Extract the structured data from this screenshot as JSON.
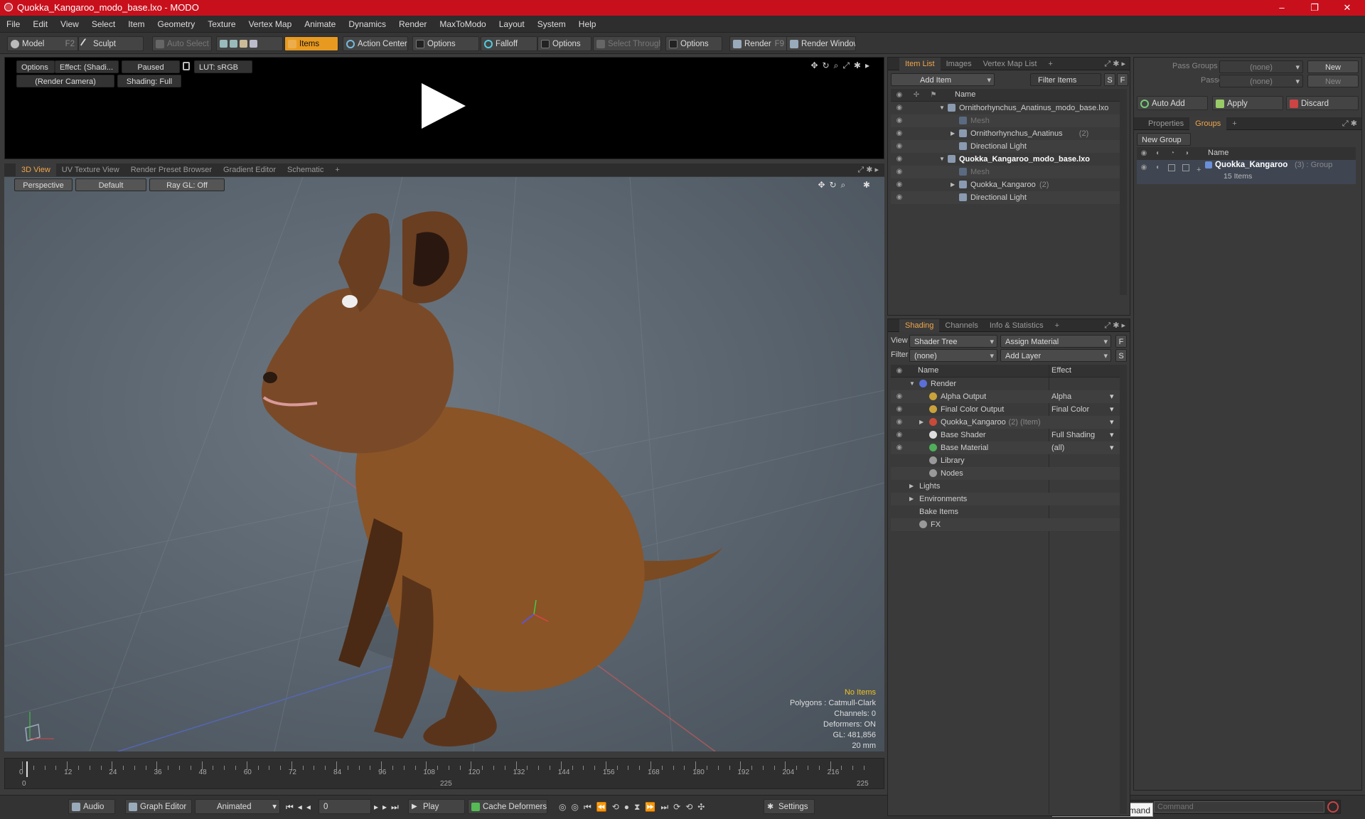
{
  "window": {
    "title": "Quokka_Kangaroo_modo_base.lxo - MODO",
    "minimize": "–",
    "restore": "❐",
    "close": "✕"
  },
  "menu": [
    "File",
    "Edit",
    "View",
    "Select",
    "Item",
    "Geometry",
    "Texture",
    "Vertex Map",
    "Animate",
    "Dynamics",
    "Render",
    "MaxToModo",
    "Layout",
    "System",
    "Help"
  ],
  "toolbar": {
    "model": "Model",
    "model_key": "F2",
    "sculpt": "Sculpt",
    "auto_select": "Auto Select",
    "items": "Items",
    "action_center": "Action Center",
    "options1": "Options",
    "falloff": "Falloff",
    "options2": "Options",
    "select_through": "Select Through",
    "options3": "Options",
    "render": "Render",
    "render_key": "F9",
    "render_window": "Render Window"
  },
  "preview": {
    "options": "Options",
    "effect": "Effect: (Shadi...",
    "paused": "Paused",
    "lut": "LUT: sRGB",
    "camera": "(Render Camera)",
    "shading": "Shading: Full"
  },
  "viewport_tabs": [
    {
      "label": "3D View",
      "active": true
    },
    {
      "label": "UV Texture View"
    },
    {
      "label": "Render Preset Browser"
    },
    {
      "label": "Gradient Editor"
    },
    {
      "label": "Schematic"
    },
    {
      "label": "+"
    }
  ],
  "viewport": {
    "perspective": "Perspective",
    "default": "Default",
    "raygl": "Ray GL: Off",
    "info": {
      "no_items": "No Items",
      "polygons": "Polygons : Catmull-Clark",
      "channels": "Channels: 0",
      "deformers": "Deformers: ON",
      "gl": "GL: 481,856",
      "size": "20 mm"
    }
  },
  "timeline": {
    "ticks": [
      "0",
      "12",
      "24",
      "36",
      "48",
      "60",
      "72",
      "84",
      "96",
      "108",
      "120",
      "132",
      "144",
      "156",
      "168",
      "180",
      "192",
      "204",
      "216"
    ],
    "start": "0",
    "mid": "225",
    "end": "225"
  },
  "bottom": {
    "audio": "Audio",
    "graph_editor": "Graph Editor",
    "animated": "Animated",
    "frame": "0",
    "play": "Play",
    "cache_deformers": "Cache Deformers",
    "settings": "Settings",
    "tooltip": "Sound Blaster Command",
    "command_placeholder": "Command"
  },
  "item_list": {
    "tabs": [
      {
        "label": "Item List",
        "active": true
      },
      {
        "label": "Images"
      },
      {
        "label": "Vertex Map List"
      },
      {
        "label": "+"
      }
    ],
    "add_item": "Add Item",
    "filter": "Filter Items",
    "s": "S",
    "f": "F",
    "col_name": "Name",
    "rows": [
      {
        "label": "Ornithorhynchus_Anatinus_modo_base.lxo",
        "indent": 0,
        "arrow": "▼",
        "bold": false,
        "dim": false,
        "count": ""
      },
      {
        "label": "Mesh",
        "indent": 1,
        "arrow": "",
        "bold": false,
        "dim": true,
        "count": ""
      },
      {
        "label": "Ornithorhynchus_Anatinus",
        "indent": 1,
        "arrow": "▶",
        "bold": false,
        "dim": false,
        "count": "(2)"
      },
      {
        "label": "Directional Light",
        "indent": 1,
        "arrow": "",
        "bold": false,
        "dim": false,
        "count": ""
      },
      {
        "label": "Quokka_Kangaroo_modo_base.lxo",
        "indent": 0,
        "arrow": "▼",
        "bold": true,
        "dim": false,
        "count": ""
      },
      {
        "label": "Mesh",
        "indent": 1,
        "arrow": "",
        "bold": false,
        "dim": true,
        "count": ""
      },
      {
        "label": "Quokka_Kangaroo",
        "indent": 1,
        "arrow": "▶",
        "bold": false,
        "dim": false,
        "count": "(2)"
      },
      {
        "label": "Directional Light",
        "indent": 1,
        "arrow": "",
        "bold": false,
        "dim": false,
        "count": ""
      }
    ]
  },
  "shading": {
    "tabs": [
      {
        "label": "Shading",
        "active": true
      },
      {
        "label": "Channels"
      },
      {
        "label": "Info & Statistics"
      },
      {
        "label": "+"
      }
    ],
    "view_label": "View",
    "view_value": "Shader Tree",
    "assign_material": "Assign Material",
    "f": "F",
    "filter_label": "Filter",
    "filter_value": "(none)",
    "add_layer": "Add Layer",
    "s": "S",
    "col_name": "Name",
    "col_effect": "Effect",
    "rows": [
      {
        "label": "Render",
        "indent": 0,
        "arrow": "▼",
        "eye": false,
        "effect": "",
        "dd": false,
        "extra": "",
        "color": "#5a6fd8"
      },
      {
        "label": "Alpha Output",
        "indent": 1,
        "arrow": "",
        "eye": true,
        "effect": "Alpha",
        "dd": true,
        "extra": "",
        "color": "#c9a23a"
      },
      {
        "label": "Final Color Output",
        "indent": 1,
        "arrow": "",
        "eye": true,
        "effect": "Final Color",
        "dd": true,
        "extra": "",
        "color": "#c9a23a"
      },
      {
        "label": "Quokka_Kangaroo",
        "indent": 1,
        "arrow": "▶",
        "eye": true,
        "effect": "",
        "dd": true,
        "extra": "(2) (Item)",
        "color": "#c84b3a"
      },
      {
        "label": "Base Shader",
        "indent": 1,
        "arrow": "",
        "eye": true,
        "effect": "Full Shading",
        "dd": true,
        "extra": "",
        "color": "#dddddd"
      },
      {
        "label": "Base Material",
        "indent": 1,
        "arrow": "",
        "eye": true,
        "effect": "(all)",
        "dd": true,
        "extra": "",
        "color": "#4fae5a"
      },
      {
        "label": "Library",
        "indent": 1,
        "arrow": "",
        "eye": false,
        "effect": "",
        "dd": false,
        "extra": "",
        "color": "#999999"
      },
      {
        "label": "Nodes",
        "indent": 1,
        "arrow": "",
        "eye": false,
        "effect": "",
        "dd": false,
        "extra": "",
        "color": "#999999"
      },
      {
        "label": "Lights",
        "indent": 0,
        "arrow": "▶",
        "eye": false,
        "effect": "",
        "dd": false,
        "extra": "",
        "color": ""
      },
      {
        "label": "Environments",
        "indent": 0,
        "arrow": "▶",
        "eye": false,
        "effect": "",
        "dd": false,
        "extra": "",
        "color": ""
      },
      {
        "label": "Bake Items",
        "indent": 0,
        "arrow": "",
        "eye": false,
        "effect": "",
        "dd": false,
        "extra": "",
        "color": ""
      },
      {
        "label": "FX",
        "indent": 0,
        "arrow": "",
        "eye": false,
        "effect": "",
        "dd": false,
        "extra": "",
        "color": "#999999"
      }
    ]
  },
  "groups": {
    "pass_groups": "Pass Groups",
    "pass_value": "(none)",
    "new": "New",
    "passes": "Passes",
    "passes_value": "(none)",
    "new2": "New",
    "auto_add": "Auto Add",
    "apply": "Apply",
    "discard": "Discard",
    "tabs": [
      {
        "label": "Properties"
      },
      {
        "label": "Groups",
        "active": true
      },
      {
        "label": "+"
      }
    ],
    "new_group": "New Group",
    "col_name": "Name",
    "item": {
      "label": "Quokka_Kangaroo",
      "type": "(3) : Group",
      "count": "15 Items"
    }
  },
  "colors": {
    "title_bg": "#c8101c",
    "accent": "#e89a20",
    "tab_active": "#f0a64b",
    "info_yellow": "#f0c020"
  }
}
